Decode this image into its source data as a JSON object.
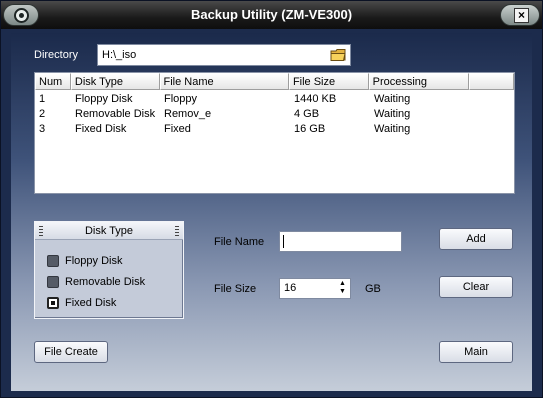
{
  "window": {
    "title": "Backup Utility (ZM-VE300)"
  },
  "icons": {
    "app": "app-ring-icon",
    "close": "close-x-icon",
    "folder": "folder-icon",
    "spin": "spin-arrows-icon"
  },
  "directory": {
    "label": "Directory",
    "value": "H:\\_iso"
  },
  "table": {
    "headers": [
      "Num",
      "Disk Type",
      "File Name",
      "File Size",
      "Processing",
      ""
    ],
    "rows": [
      [
        "1",
        "Floppy Disk",
        "Floppy",
        "1440 KB",
        "Waiting"
      ],
      [
        "2",
        "Removable Disk",
        "Remov_e",
        "4 GB",
        "Waiting"
      ],
      [
        "3",
        "Fixed Disk",
        "Fixed",
        "16 GB",
        "Waiting"
      ]
    ]
  },
  "disk_type": {
    "title": "Disk Type",
    "options": [
      "Floppy Disk",
      "Removable Disk",
      "Fixed Disk"
    ],
    "selected": "Fixed Disk"
  },
  "form": {
    "file_name_label": "File Name",
    "file_name_value": "",
    "file_size_label": "File Size",
    "file_size_value": "16",
    "file_size_unit": "GB",
    "spin_up": "▲",
    "spin_down": "▼"
  },
  "buttons": {
    "add": "Add",
    "clear": "Clear",
    "file_create": "File Create",
    "main": "Main"
  },
  "close_glyph": "×",
  "colors": {
    "title_bar": "#1a1a1a",
    "body_top": "#1b2a4b",
    "body_bottom": "#c5cdd9",
    "panel": "#c4cbd9"
  }
}
